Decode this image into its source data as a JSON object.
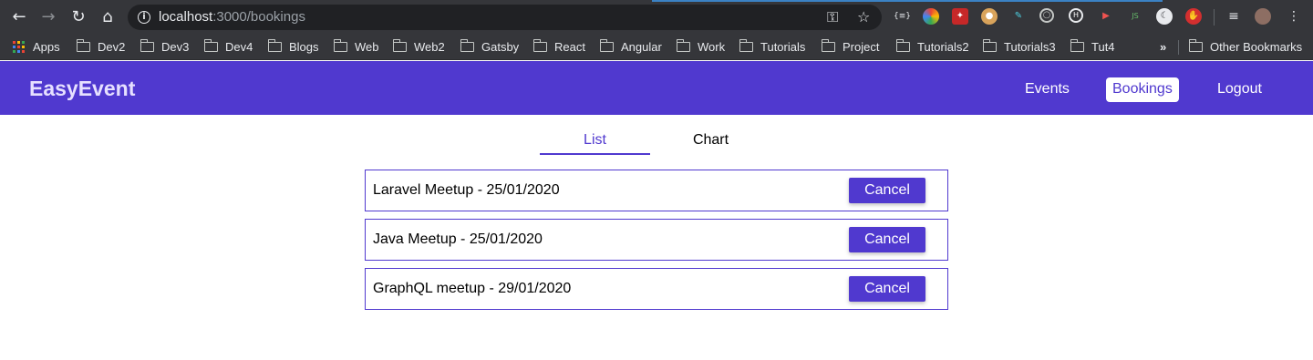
{
  "browser": {
    "url_host": "localhost",
    "url_path": ":3000/bookings",
    "bookmarks": [
      {
        "label": "Apps",
        "type": "apps"
      },
      {
        "label": "Dev2",
        "type": "folder"
      },
      {
        "label": "Dev3",
        "type": "folder"
      },
      {
        "label": "Dev4",
        "type": "folder"
      },
      {
        "label": "Blogs",
        "type": "folder"
      },
      {
        "label": "Web",
        "type": "folder"
      },
      {
        "label": "Web2",
        "type": "folder"
      },
      {
        "label": "Gatsby",
        "type": "folder"
      },
      {
        "label": "React",
        "type": "folder"
      },
      {
        "label": "Angular",
        "type": "folder"
      },
      {
        "label": "Work",
        "type": "folder"
      },
      {
        "label": "Tutorials",
        "type": "folder"
      },
      {
        "label": "Project",
        "type": "folder"
      },
      {
        "label": "Tutorials2",
        "type": "folder"
      },
      {
        "label": "Tutorials3",
        "type": "folder"
      },
      {
        "label": "Tut4",
        "type": "folder"
      }
    ],
    "overflow_label": "»",
    "other_bookmarks": "Other Bookmarks"
  },
  "header": {
    "logo": "EasyEvent",
    "nav": {
      "events": "Events",
      "bookings": "Bookings",
      "logout": "Logout"
    }
  },
  "tabs": {
    "list": "List",
    "chart": "Chart",
    "active": "list"
  },
  "bookings": [
    {
      "title": "Laravel Meetup - 25/01/2020",
      "action": "Cancel"
    },
    {
      "title": "Java Meetup - 25/01/2020",
      "action": "Cancel"
    },
    {
      "title": "GraphQL meetup - 29/01/2020",
      "action": "Cancel"
    }
  ],
  "colors": {
    "brand": "#5039cf",
    "chrome_bg": "#35363a",
    "omnibox_bg": "#202124"
  }
}
